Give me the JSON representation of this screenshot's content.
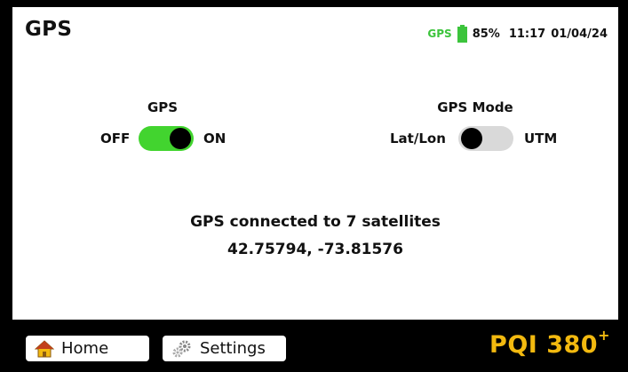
{
  "header": {
    "title": "GPS"
  },
  "status": {
    "gps_label": "GPS",
    "battery": "85%",
    "time": "11:17",
    "date": "01/04/24",
    "battery_color": "#3cc43c"
  },
  "gps_toggle": {
    "label": "GPS",
    "off_label": "OFF",
    "on_label": "ON",
    "state": "on"
  },
  "mode_toggle": {
    "label": "GPS Mode",
    "left_label": "Lat/Lon",
    "right_label": "UTM",
    "state": "Lat/Lon"
  },
  "message": {
    "line1": "GPS connected to 7 satellites",
    "line2": "42.75794, -73.81576"
  },
  "footer": {
    "home_label": "Home",
    "home_icon": "home-icon",
    "settings_label": "Settings",
    "settings_icon": "gears-icon",
    "brand": "PQI 380",
    "brand_sup": "+",
    "brand_color": "#f2b90f"
  }
}
